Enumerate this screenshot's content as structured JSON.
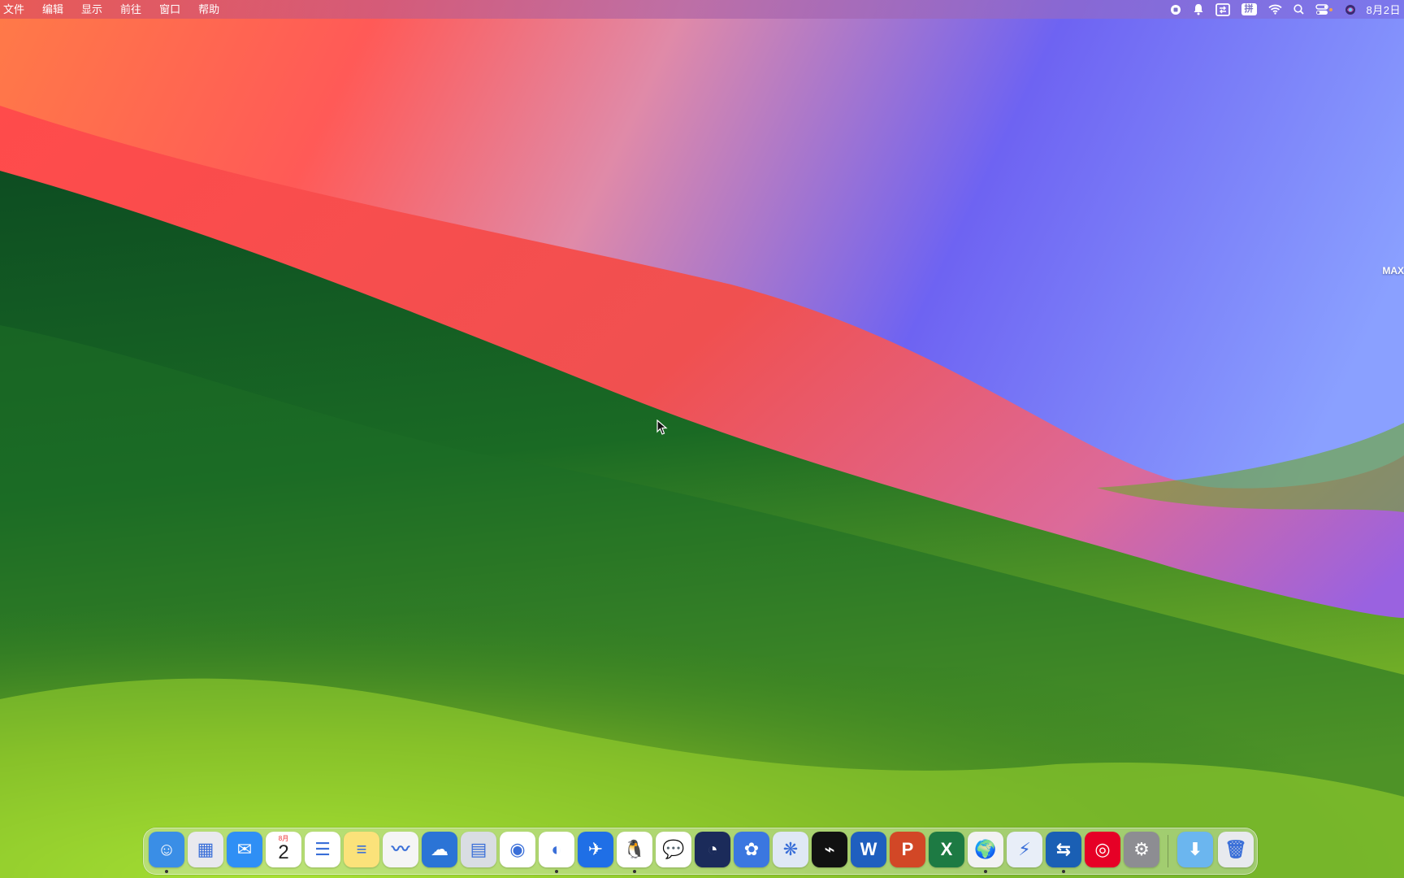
{
  "menubar": {
    "menus": [
      "文件",
      "编辑",
      "显示",
      "前往",
      "窗口",
      "帮助"
    ],
    "status_icons": [
      "record-icon",
      "qq-bell-icon",
      "screen-share-icon",
      "input-method-icon",
      "wifi-icon",
      "search-icon",
      "control-center-icon",
      "siri-icon"
    ],
    "input_method_label": "拼",
    "clock": "8月2日"
  },
  "desktop": {
    "label": "MAX"
  },
  "dock": {
    "apps": [
      {
        "name": "finder",
        "color": "#3a8ee6",
        "glyph": "☺",
        "running": true
      },
      {
        "name": "launchpad",
        "color": "#e9e9ee",
        "glyph": "▦",
        "running": false
      },
      {
        "name": "mail",
        "color": "#2f8ff5",
        "glyph": "✉",
        "running": false
      },
      {
        "name": "calendar",
        "color": "#ffffff",
        "glyph": "",
        "running": false
      },
      {
        "name": "reminders",
        "color": "#ffffff",
        "glyph": "☰",
        "running": false
      },
      {
        "name": "notes",
        "color": "#fbe27a",
        "glyph": "≡",
        "running": false
      },
      {
        "name": "freeform",
        "color": "#f5f5f5",
        "glyph": "〰",
        "running": false
      },
      {
        "name": "weather-cloud",
        "color": "#2b74d6",
        "glyph": "☁",
        "running": false
      },
      {
        "name": "preview",
        "color": "#d9dde3",
        "glyph": "▤",
        "running": false
      },
      {
        "name": "chrome",
        "color": "#ffffff",
        "glyph": "◉",
        "running": false
      },
      {
        "name": "edge",
        "color": "#ffffff",
        "glyph": "◐",
        "running": true
      },
      {
        "name": "feishu",
        "color": "#1f6fe6",
        "glyph": "✈",
        "running": false
      },
      {
        "name": "qq",
        "color": "#ffffff",
        "glyph": "🐧",
        "running": true
      },
      {
        "name": "wechat",
        "color": "#ffffff",
        "glyph": "💬",
        "running": false
      },
      {
        "name": "cinema4d",
        "color": "#1b2b5a",
        "glyph": "◔",
        "running": false
      },
      {
        "name": "mascot-app",
        "color": "#3b77e0",
        "glyph": "✿",
        "running": false
      },
      {
        "name": "fish-app",
        "color": "#dfe8f5",
        "glyph": "❋",
        "running": false
      },
      {
        "name": "capcut",
        "color": "#111111",
        "glyph": "⌁",
        "running": false
      },
      {
        "name": "word",
        "color": "#1f5fbf",
        "glyph": "W",
        "running": false
      },
      {
        "name": "powerpoint",
        "color": "#d24726",
        "glyph": "P",
        "running": false
      },
      {
        "name": "excel",
        "color": "#1d7a43",
        "glyph": "X",
        "running": false
      },
      {
        "name": "globe-app",
        "color": "#f2f2f2",
        "glyph": "🌍",
        "running": true
      },
      {
        "name": "thunder",
        "color": "#e8eef8",
        "glyph": "⚡",
        "running": false
      },
      {
        "name": "remote-desktop",
        "color": "#1a5fb4",
        "glyph": "⇆",
        "running": true
      },
      {
        "name": "netease-music",
        "color": "#e60026",
        "glyph": "◎",
        "running": false
      },
      {
        "name": "system-settings",
        "color": "#8d8d92",
        "glyph": "⚙",
        "running": false
      }
    ],
    "calendar": {
      "month": "8月",
      "day": "2"
    },
    "right_items": [
      {
        "name": "downloads",
        "color": "#6bb6ef",
        "glyph": "⬇"
      },
      {
        "name": "trash",
        "color": "#e8eaee",
        "glyph": "🗑"
      }
    ]
  }
}
